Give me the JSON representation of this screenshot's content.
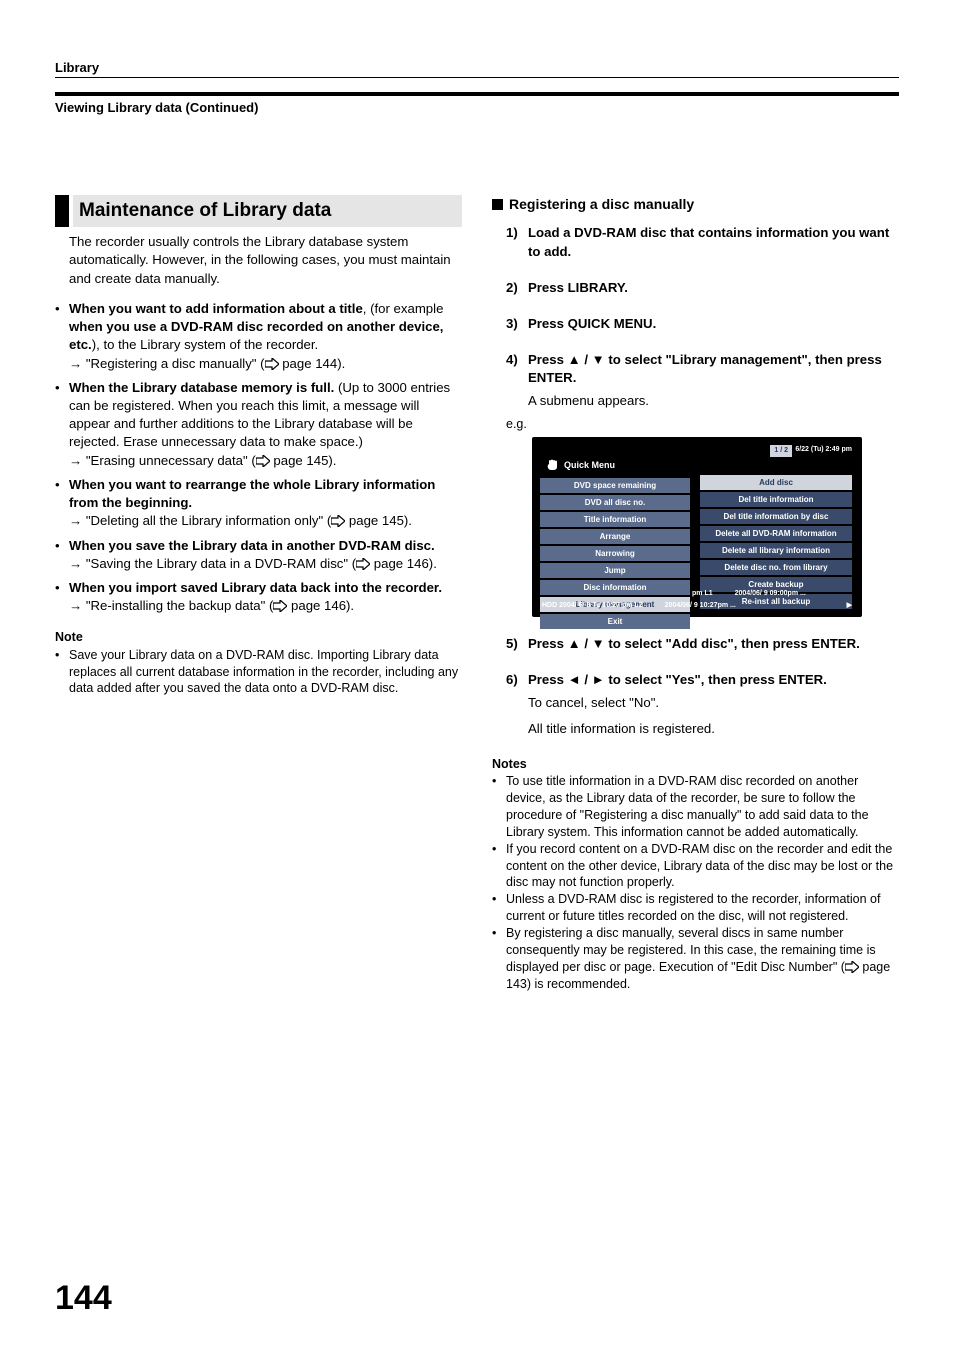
{
  "header": {
    "category": "Library",
    "continued": "Viewing Library data (Continued)"
  },
  "left": {
    "section_title": "Maintenance of Library data",
    "intro": "The recorder usually controls the Library database system automatically. However, in the following cases, you must maintain and create data manually.",
    "b1_lead": "When you want to add information about a title",
    "b1_mid": ", (for example ",
    "b1_bold2": "when you use a DVD-RAM disc recorded on another device, etc.",
    "b1_tail": "), to the Library system of the recorder.",
    "b1_ref": "→ \"Registering a disc manually\" (",
    "b1_ref_tail": " page 144).",
    "b2_lead": "When the Library database memory is full.",
    "b2_body": " (Up to 3000 entries can be registered. When you reach this limit, a message will appear and further additions to the Library database will be rejected. Erase unnecessary data to make space.)",
    "b2_ref": "→ \"Erasing unnecessary data\" (",
    "b2_ref_tail": " page 145).",
    "b3_lead": "When you want to rearrange the whole Library information from the beginning.",
    "b3_ref": "→ \"Deleting all the Library information only\" (",
    "b3_ref_tail": " page 145).",
    "b4_lead": "When you save the Library data in another DVD-RAM disc.",
    "b4_ref": "→ \"Saving the Library data in a DVD-RAM disc\" (",
    "b4_ref_tail": " page 146).",
    "b5_lead": "When you import saved Library data back into the recorder.",
    "b5_ref": "→ \"Re-installing the backup data\" (",
    "b5_ref_tail": " page 146).",
    "note_head": "Note",
    "note_body": "Save your Library data on a DVD-RAM disc. Importing Library data replaces all current database information in the recorder, including any data added after you saved the data onto a DVD-RAM disc."
  },
  "right": {
    "subhead": "Registering a disc manually",
    "s1": "Load a DVD-RAM disc that contains information you want to add.",
    "s2": "Press LIBRARY.",
    "s3": "Press QUICK MENU.",
    "s4_pre": "Press ",
    "s4_mid": " to select \"Library management\", then press ENTER.",
    "s4_sub": "A submenu appears.",
    "eg": "e.g.",
    "s5_pre": "Press ",
    "s5_mid": " to select \"Add disc\", then press ENTER.",
    "s6_pre": "Press ",
    "s6_mid": " to select \"Yes\", then press ENTER.",
    "s6_sub1": "To cancel, select \"No\".",
    "s6_sub2": "All title information is registered.",
    "notes_head": "Notes",
    "n1": "To use title information in a DVD-RAM disc recorded on another device, as the Library data of the recorder, be sure to follow the procedure of \"Registering a disc manually\" to add said data to the Library system. This information cannot be added automatically.",
    "n2": "If you record content on a DVD-RAM disc on the recorder and edit the content on the other device, Library data of the disc may be lost or the disc may not function properly.",
    "n3": "Unless a DVD-RAM disc is registered to the recorder, information of current or future titles recorded on the disc, will not registered.",
    "n4_a": "By registering a disc manually, several discs in same number consequently may be registered. In this case, the remaining time is displayed per disc or page. Execution of \"Edit Disc Number\" (",
    "n4_b": " page 143) is recommended.",
    "updown": "▲ / ▼",
    "leftright": "◄ / ►"
  },
  "menu": {
    "qm_title": "Quick Menu",
    "qm": [
      "DVD space remaining",
      "DVD all disc no.",
      "Title information",
      "Arrange",
      "Narrowing",
      "Jump",
      "Disc information",
      "Library management",
      "Exit"
    ],
    "sm": [
      "Add disc",
      "Del title information",
      "Del title information by disc",
      "Delete all DVD-RAM information",
      "Delete all library information",
      "Delete disc no. from library",
      "Create backup",
      "Re-inst all backup"
    ],
    "chip": "1 / 2",
    "date": "6/22 (Tu)   2:49 pm",
    "bot1_a": "pm  L1",
    "bot1_b": "2004/06/ 9   09:00pm ...",
    "bot2_a": "HDD   2004/ 6/ 8   Tu   10:27 pm  L2",
    "bot2_b": "2004/06/ 9   10:27pm ..."
  },
  "page_number": "144"
}
